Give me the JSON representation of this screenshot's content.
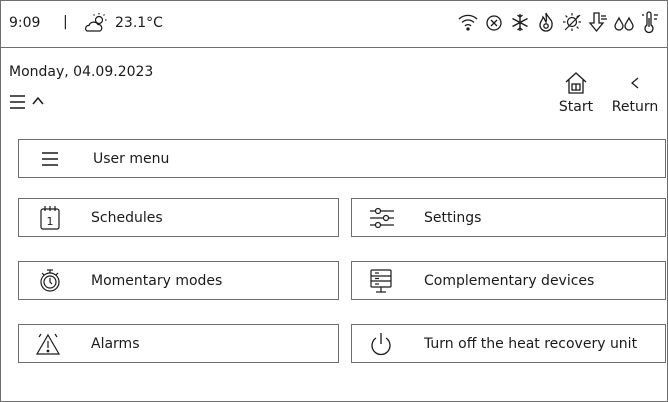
{
  "status": {
    "time": "9:09",
    "separator": "|",
    "temperature": "23.1°C",
    "weather_icon": "partly-sunny-icon",
    "icons": [
      "wifi-icon",
      "x-circle-icon",
      "snowflake-icon",
      "flame-icon",
      "sun-off-icon",
      "fan-down-icon",
      "drops-icon",
      "thermometer-icon"
    ]
  },
  "header": {
    "date": "Monday, 04.09.2023",
    "start_label": "Start",
    "return_label": "Return"
  },
  "menu": {
    "user_menu": "User menu",
    "schedules": "Schedules",
    "schedules_icon_day": "1",
    "settings": "Settings",
    "momentary_modes": "Momentary modes",
    "complementary_devices": "Complementary devices",
    "alarms": "Alarms",
    "turn_off": "Turn off the heat recovery unit"
  },
  "colors": {
    "border": "#6e6e6e",
    "text": "#1a1a1a",
    "background": "#ffffff"
  }
}
